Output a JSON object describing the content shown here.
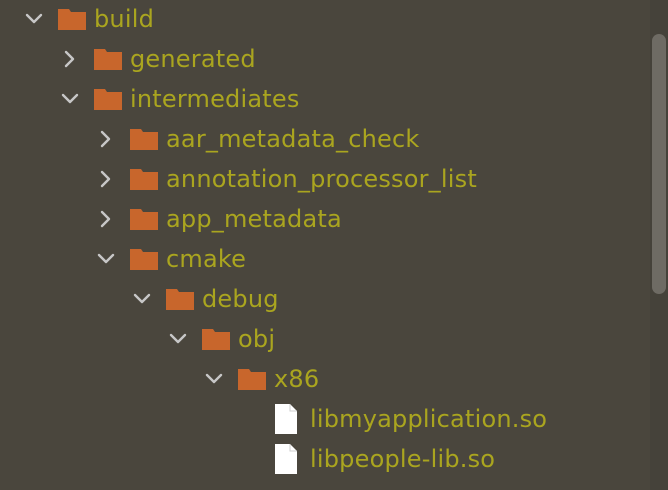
{
  "tree": {
    "rows": [
      {
        "label": "build",
        "type": "folder",
        "depth": 0,
        "state": "expanded"
      },
      {
        "label": "generated",
        "type": "folder",
        "depth": 1,
        "state": "collapsed"
      },
      {
        "label": "intermediates",
        "type": "folder",
        "depth": 1,
        "state": "expanded"
      },
      {
        "label": "aar_metadata_check",
        "type": "folder",
        "depth": 2,
        "state": "collapsed"
      },
      {
        "label": "annotation_processor_list",
        "type": "folder",
        "depth": 2,
        "state": "collapsed"
      },
      {
        "label": "app_metadata",
        "type": "folder",
        "depth": 2,
        "state": "collapsed"
      },
      {
        "label": "cmake",
        "type": "folder",
        "depth": 2,
        "state": "expanded"
      },
      {
        "label": "debug",
        "type": "folder",
        "depth": 3,
        "state": "expanded"
      },
      {
        "label": "obj",
        "type": "folder",
        "depth": 4,
        "state": "expanded"
      },
      {
        "label": "x86",
        "type": "folder",
        "depth": 5,
        "state": "expanded"
      },
      {
        "label": "libmyapplication.so",
        "type": "file",
        "depth": 6,
        "state": "leaf"
      },
      {
        "label": "libpeople-lib.so",
        "type": "file",
        "depth": 6,
        "state": "leaf"
      }
    ]
  },
  "colors": {
    "background": "#4a463d",
    "label": "#aaa51f",
    "folder": "#c8662c",
    "chevron": "#c7c7c7",
    "file": "#ffffff"
  },
  "icons": {
    "expanded": "chevron-down-icon",
    "collapsed": "chevron-right-icon",
    "folder": "folder-icon",
    "file": "file-icon"
  }
}
